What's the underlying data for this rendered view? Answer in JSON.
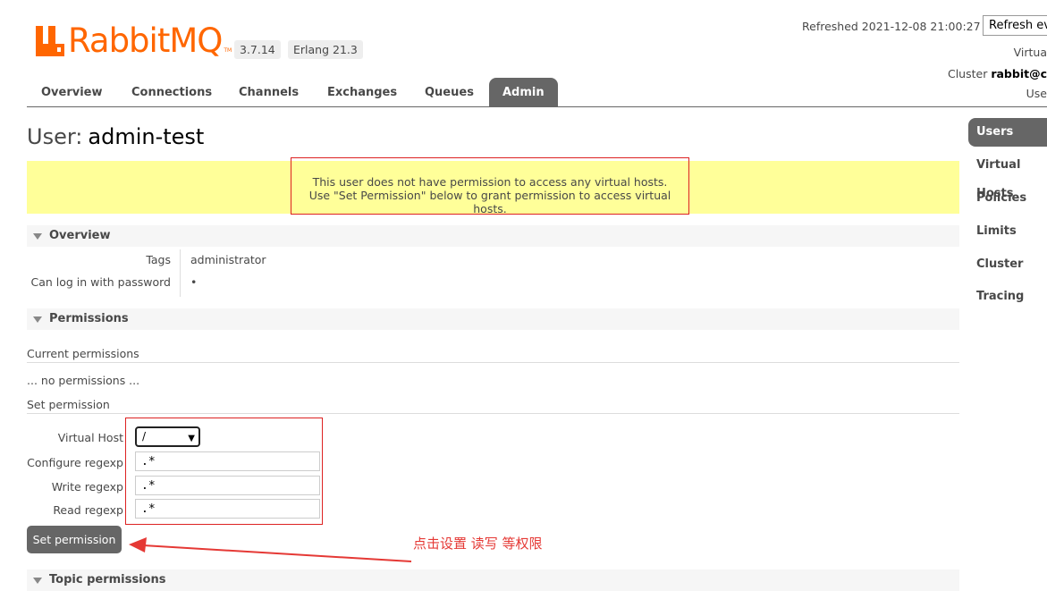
{
  "header": {
    "logo_text": "RabbitMQ",
    "logo_tm": "TM",
    "version": "3.7.14",
    "erlang": "Erlang 21.3",
    "refreshed": "Refreshed 2021-12-08 21:00:27",
    "refresh_select": "Refresh ev",
    "virtual_label": "Virtua",
    "cluster_label": "Cluster",
    "cluster_value": "rabbit@c",
    "user_label": "Use"
  },
  "tabs": [
    {
      "label": "Overview"
    },
    {
      "label": "Connections"
    },
    {
      "label": "Channels"
    },
    {
      "label": "Exchanges"
    },
    {
      "label": "Queues"
    },
    {
      "label": "Admin"
    }
  ],
  "page": {
    "title_prefix": "User:",
    "title_name": "admin-test"
  },
  "warning": {
    "line1": "This user does not have permission to access any virtual hosts.",
    "line2": "Use \"Set Permission\" below to grant permission to access virtual hosts."
  },
  "overview": {
    "header": "Overview",
    "tags_label": "Tags",
    "tags_value": "administrator",
    "login_label": "Can log in with password",
    "login_value": "•"
  },
  "permissions": {
    "header": "Permissions",
    "current_title": "Current permissions",
    "none_text": "... no permissions ...",
    "set_title": "Set permission",
    "vhost_label": "Virtual Host",
    "vhost_value": "/",
    "configure_label": "Configure regexp",
    "configure_value": ".*",
    "write_label": "Write regexp",
    "write_value": ".*",
    "read_label": "Read regexp",
    "read_value": ".*",
    "button": "Set permission"
  },
  "annotation": "点击设置 读写 等权限",
  "topic": {
    "header": "Topic permissions"
  },
  "sidebar": [
    {
      "label": "Users"
    },
    {
      "label": "Virtual Hosts"
    },
    {
      "label": "Policies"
    },
    {
      "label": "Limits"
    },
    {
      "label": "Cluster"
    },
    {
      "label": "Tracing"
    }
  ],
  "colors": {
    "brand": "#ff6600",
    "tab_active": "#666666",
    "warning_bg": "#ffff99",
    "annotation_red": "#e53935"
  }
}
